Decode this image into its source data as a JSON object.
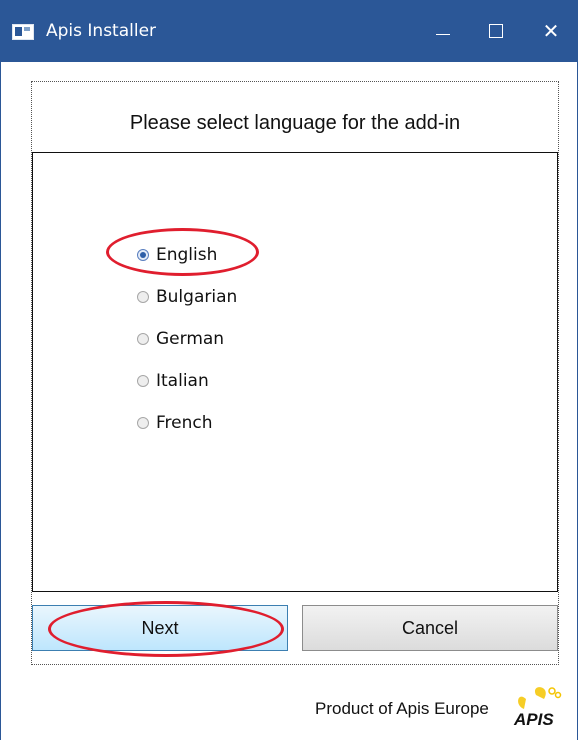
{
  "window": {
    "title": "Apis Installer",
    "icon": "app-window-icon"
  },
  "controls": {
    "minimize": "minimize-icon",
    "maximize": "maximize-icon",
    "close_symbol": "✕"
  },
  "prompt": "Please select language for the add-in",
  "languages": [
    {
      "label": "English",
      "selected": true
    },
    {
      "label": "Bulgarian",
      "selected": false
    },
    {
      "label": "German",
      "selected": false
    },
    {
      "label": "Italian",
      "selected": false
    },
    {
      "label": "French",
      "selected": false
    }
  ],
  "buttons": {
    "next": "Next",
    "cancel": "Cancel"
  },
  "footer": {
    "text": "Product of Apis Europe",
    "logo_text": "APIS"
  },
  "colors": {
    "titlebar": "#2b5797",
    "annotation": "#e01e2e",
    "logo": "#f4c400"
  }
}
